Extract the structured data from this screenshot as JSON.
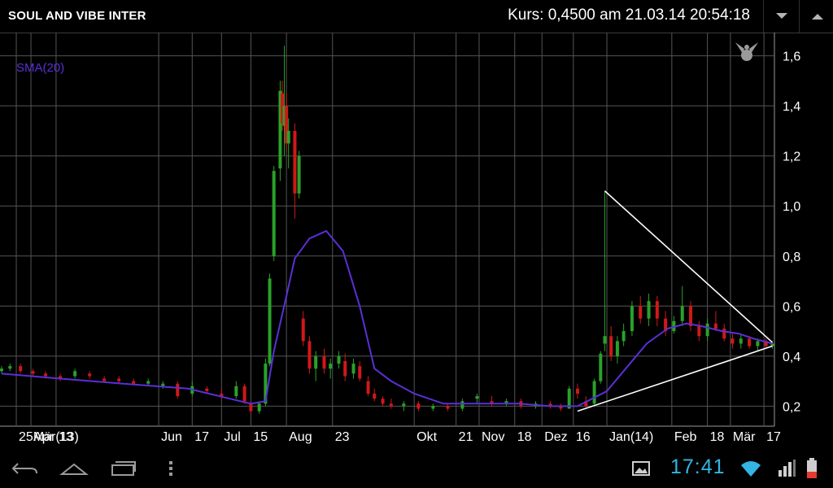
{
  "app": {
    "title": "SOUL AND VIBE INTER",
    "quote": "Kurs: 0,4500 am 21.03.14 20:54:18"
  },
  "toolbar": {
    "down_icon": "chevron-down-icon",
    "up_icon": "chevron-up-icon"
  },
  "indicator": {
    "label": "SMA(20)",
    "color": "#5b2fd6"
  },
  "status_bar": {
    "time": "17:41",
    "icons": [
      "back-icon",
      "home-icon",
      "recent-apps-icon",
      "menu-icon",
      "screenshot-icon",
      "wifi-icon",
      "signal-icon",
      "battery-icon"
    ]
  },
  "colors": {
    "up": "#2aa12a",
    "down": "#d01818",
    "sma": "#5b2fd6",
    "trendline": "#ffffff",
    "grid": "#555555",
    "clock": "#33b5e5"
  },
  "chart_data": {
    "type": "candlestick",
    "title": "",
    "y_ticks": [
      "0,2",
      "0,4",
      "0,6",
      "0,8",
      "1,0",
      "1,2",
      "1,4",
      "1,6"
    ],
    "ylim": [
      0.12,
      1.68
    ],
    "x_ticks": [
      "25Mär(13)",
      "Apr",
      "13",
      "Jun",
      "17",
      "Jul",
      "15",
      "Aug",
      "23",
      "Okt",
      "21",
      "Nov",
      "18",
      "Dez",
      "16",
      "Jan(14)",
      "Feb",
      "18",
      "Mär",
      "17"
    ],
    "x_tick_dates": [
      "2013-03-25",
      "2013-04-01",
      "2013-04-13",
      "2013-06-01",
      "2013-06-17",
      "2013-07-01",
      "2013-07-15",
      "2013-08-01",
      "2013-08-23",
      "2013-10-01",
      "2013-10-21",
      "2013-11-01",
      "2013-11-18",
      "2013-12-01",
      "2013-12-16",
      "2014-01-01",
      "2014-02-01",
      "2014-02-18",
      "2014-03-01",
      "2014-03-17"
    ],
    "series": [
      {
        "name": "SMA(20)",
        "points": [
          [
            "2013-03-18",
            0.33
          ],
          [
            "2013-04-15",
            0.31
          ],
          [
            "2013-05-15",
            0.29
          ],
          [
            "2013-06-15",
            0.27
          ],
          [
            "2013-07-05",
            0.23
          ],
          [
            "2013-07-15",
            0.21
          ],
          [
            "2013-07-22",
            0.22
          ],
          [
            "2013-07-26",
            0.42
          ],
          [
            "2013-08-01",
            0.64
          ],
          [
            "2013-08-05",
            0.79
          ],
          [
            "2013-08-12",
            0.87
          ],
          [
            "2013-08-20",
            0.9
          ],
          [
            "2013-08-28",
            0.82
          ],
          [
            "2013-09-05",
            0.6
          ],
          [
            "2013-09-12",
            0.35
          ],
          [
            "2013-09-20",
            0.3
          ],
          [
            "2013-10-01",
            0.25
          ],
          [
            "2013-10-15",
            0.21
          ],
          [
            "2013-11-01",
            0.21
          ],
          [
            "2013-11-20",
            0.21
          ],
          [
            "2013-12-05",
            0.2
          ],
          [
            "2013-12-18",
            0.2
          ],
          [
            "2014-01-01",
            0.26
          ],
          [
            "2014-01-10",
            0.35
          ],
          [
            "2014-01-20",
            0.45
          ],
          [
            "2014-01-30",
            0.51
          ],
          [
            "2014-02-08",
            0.53
          ],
          [
            "2014-02-15",
            0.52
          ],
          [
            "2014-02-25",
            0.5
          ],
          [
            "2014-03-05",
            0.49
          ],
          [
            "2014-03-12",
            0.47
          ],
          [
            "2014-03-21",
            0.45
          ]
        ]
      }
    ],
    "candles": [
      [
        "2013-03-18",
        0.34,
        0.36,
        0.33,
        0.35
      ],
      [
        "2013-03-22",
        0.35,
        0.37,
        0.34,
        0.36
      ],
      [
        "2013-03-27",
        0.36,
        0.37,
        0.33,
        0.34
      ],
      [
        "2013-04-02",
        0.34,
        0.35,
        0.32,
        0.33
      ],
      [
        "2013-04-08",
        0.33,
        0.34,
        0.31,
        0.32
      ],
      [
        "2013-04-15",
        0.32,
        0.33,
        0.3,
        0.31
      ],
      [
        "2013-04-22",
        0.32,
        0.35,
        0.31,
        0.34
      ],
      [
        "2013-04-29",
        0.33,
        0.34,
        0.31,
        0.32
      ],
      [
        "2013-05-06",
        0.31,
        0.32,
        0.3,
        0.3
      ],
      [
        "2013-05-13",
        0.31,
        0.32,
        0.29,
        0.3
      ],
      [
        "2013-05-20",
        0.3,
        0.31,
        0.29,
        0.29
      ],
      [
        "2013-05-27",
        0.29,
        0.31,
        0.28,
        0.3
      ],
      [
        "2013-06-03",
        0.28,
        0.3,
        0.27,
        0.29
      ],
      [
        "2013-06-10",
        0.29,
        0.3,
        0.23,
        0.24
      ],
      [
        "2013-06-17",
        0.25,
        0.3,
        0.24,
        0.28
      ],
      [
        "2013-06-24",
        0.27,
        0.28,
        0.25,
        0.26
      ],
      [
        "2013-07-01",
        0.25,
        0.27,
        0.23,
        0.24
      ],
      [
        "2013-07-08",
        0.24,
        0.3,
        0.23,
        0.28
      ],
      [
        "2013-07-12",
        0.28,
        0.29,
        0.21,
        0.22
      ],
      [
        "2013-07-15",
        0.21,
        0.22,
        0.17,
        0.18
      ],
      [
        "2013-07-19",
        0.18,
        0.22,
        0.17,
        0.21
      ],
      [
        "2013-07-22",
        0.21,
        0.39,
        0.2,
        0.37
      ],
      [
        "2013-07-24",
        0.37,
        0.73,
        0.36,
        0.71
      ],
      [
        "2013-07-26",
        0.8,
        1.16,
        0.78,
        1.14
      ],
      [
        "2013-07-29",
        1.15,
        1.5,
        1.1,
        1.46
      ],
      [
        "2013-07-30",
        1.45,
        1.5,
        1.3,
        1.33
      ],
      [
        "2013-07-31",
        1.32,
        1.64,
        1.2,
        1.4
      ],
      [
        "2013-08-01",
        1.4,
        1.45,
        1.22,
        1.25
      ],
      [
        "2013-08-02",
        1.25,
        1.35,
        1.15,
        1.3
      ],
      [
        "2013-08-05",
        1.3,
        1.33,
        0.95,
        1.05
      ],
      [
        "2013-08-07",
        1.05,
        1.22,
        1.03,
        1.2
      ],
      [
        "2013-08-09",
        0.55,
        0.58,
        0.44,
        0.46
      ],
      [
        "2013-08-12",
        0.46,
        0.48,
        0.33,
        0.35
      ],
      [
        "2013-08-15",
        0.35,
        0.42,
        0.3,
        0.4
      ],
      [
        "2013-08-19",
        0.4,
        0.43,
        0.33,
        0.35
      ],
      [
        "2013-08-22",
        0.35,
        0.39,
        0.31,
        0.37
      ],
      [
        "2013-08-26",
        0.37,
        0.42,
        0.35,
        0.4
      ],
      [
        "2013-08-29",
        0.38,
        0.41,
        0.3,
        0.32
      ],
      [
        "2013-09-02",
        0.33,
        0.39,
        0.31,
        0.37
      ],
      [
        "2013-09-05",
        0.36,
        0.38,
        0.3,
        0.31
      ],
      [
        "2013-09-09",
        0.3,
        0.32,
        0.24,
        0.25
      ],
      [
        "2013-09-12",
        0.25,
        0.27,
        0.22,
        0.23
      ],
      [
        "2013-09-16",
        0.23,
        0.24,
        0.2,
        0.21
      ],
      [
        "2013-09-20",
        0.21,
        0.23,
        0.19,
        0.2
      ],
      [
        "2013-09-26",
        0.2,
        0.22,
        0.18,
        0.21
      ],
      [
        "2013-10-03",
        0.21,
        0.22,
        0.18,
        0.19
      ],
      [
        "2013-10-10",
        0.19,
        0.21,
        0.18,
        0.2
      ],
      [
        "2013-10-17",
        0.2,
        0.21,
        0.18,
        0.19
      ],
      [
        "2013-10-24",
        0.19,
        0.23,
        0.18,
        0.22
      ],
      [
        "2013-10-31",
        0.23,
        0.25,
        0.21,
        0.24
      ],
      [
        "2013-11-07",
        0.22,
        0.24,
        0.2,
        0.21
      ],
      [
        "2013-11-14",
        0.21,
        0.23,
        0.2,
        0.22
      ],
      [
        "2013-11-21",
        0.22,
        0.23,
        0.19,
        0.2
      ],
      [
        "2013-11-28",
        0.2,
        0.22,
        0.19,
        0.21
      ],
      [
        "2013-12-05",
        0.21,
        0.22,
        0.19,
        0.2
      ],
      [
        "2013-12-10",
        0.2,
        0.21,
        0.18,
        0.19
      ],
      [
        "2013-12-14",
        0.19,
        0.28,
        0.19,
        0.27
      ],
      [
        "2013-12-18",
        0.27,
        0.29,
        0.23,
        0.25
      ],
      [
        "2013-12-22",
        0.22,
        0.24,
        0.19,
        0.2
      ],
      [
        "2013-12-26",
        0.21,
        0.31,
        0.2,
        0.3
      ],
      [
        "2013-12-29",
        0.3,
        0.42,
        0.29,
        0.41
      ],
      [
        "2013-12-31",
        0.45,
        1.06,
        0.42,
        0.48
      ],
      [
        "2014-01-03",
        0.48,
        0.52,
        0.38,
        0.4
      ],
      [
        "2014-01-06",
        0.4,
        0.48,
        0.37,
        0.46
      ],
      [
        "2014-01-09",
        0.46,
        0.53,
        0.44,
        0.5
      ],
      [
        "2014-01-13",
        0.5,
        0.62,
        0.48,
        0.6
      ],
      [
        "2014-01-17",
        0.6,
        0.64,
        0.53,
        0.55
      ],
      [
        "2014-01-21",
        0.55,
        0.65,
        0.52,
        0.62
      ],
      [
        "2014-01-25",
        0.62,
        0.64,
        0.52,
        0.55
      ],
      [
        "2014-01-29",
        0.55,
        0.58,
        0.48,
        0.5
      ],
      [
        "2014-02-02",
        0.5,
        0.56,
        0.49,
        0.54
      ],
      [
        "2014-02-06",
        0.54,
        0.68,
        0.52,
        0.6
      ],
      [
        "2014-02-10",
        0.6,
        0.62,
        0.5,
        0.52
      ],
      [
        "2014-02-14",
        0.52,
        0.54,
        0.46,
        0.48
      ],
      [
        "2014-02-18",
        0.48,
        0.55,
        0.46,
        0.53
      ],
      [
        "2014-02-22",
        0.53,
        0.58,
        0.5,
        0.51
      ],
      [
        "2014-02-26",
        0.51,
        0.53,
        0.46,
        0.47
      ],
      [
        "2014-03-02",
        0.47,
        0.49,
        0.43,
        0.45
      ],
      [
        "2014-03-06",
        0.45,
        0.49,
        0.43,
        0.47
      ],
      [
        "2014-03-10",
        0.47,
        0.48,
        0.43,
        0.44
      ],
      [
        "2014-03-14",
        0.44,
        0.47,
        0.42,
        0.46
      ],
      [
        "2014-03-18",
        0.46,
        0.47,
        0.43,
        0.44
      ],
      [
        "2014-03-21",
        0.44,
        0.46,
        0.43,
        0.45
      ]
    ],
    "trendlines": [
      {
        "from": [
          "2013-12-31",
          1.06
        ],
        "to": [
          "2014-03-21",
          0.455
        ]
      },
      {
        "from": [
          "2013-12-18",
          0.18
        ],
        "to": [
          "2014-03-21",
          0.44
        ]
      }
    ],
    "grid": true
  }
}
